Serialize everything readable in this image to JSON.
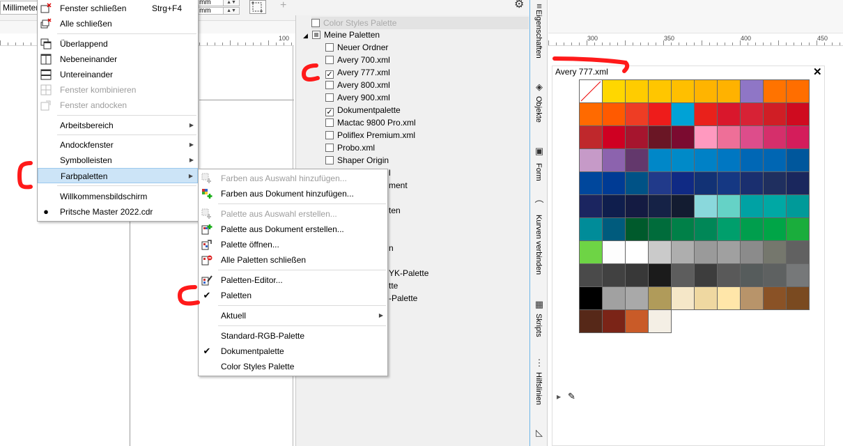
{
  "toolbar": {
    "unit_value": "Millimeter",
    "size_unit_1": "mm",
    "size_unit_2": "mm"
  },
  "ruler_left": {
    "labels": [
      "100"
    ]
  },
  "ruler_right": {
    "labels": [
      "300",
      "350",
      "400",
      "450"
    ]
  },
  "main_menu": {
    "items": [
      {
        "label": "Fenster schließen",
        "shortcut": "Strg+F4",
        "icon": "close-window-icon",
        "enabled": true
      },
      {
        "label": "Alle schließen",
        "icon": "close-all-windows-icon",
        "enabled": true
      },
      {
        "label": "Überlappend",
        "icon": "cascade-icon",
        "enabled": true
      },
      {
        "label": "Nebeneinander",
        "icon": "tile-vertical-icon",
        "enabled": true
      },
      {
        "label": "Untereinander",
        "icon": "tile-horizontal-icon",
        "enabled": true
      },
      {
        "label": "Fenster kombinieren",
        "icon": "combine-windows-icon",
        "enabled": false
      },
      {
        "label": "Fenster andocken",
        "icon": "dock-window-icon",
        "enabled": false
      },
      {
        "label": "Arbeitsbereich",
        "submenu": true,
        "enabled": true
      },
      {
        "label": "Andockfenster",
        "submenu": true,
        "enabled": true
      },
      {
        "label": "Symbolleisten",
        "submenu": true,
        "enabled": true
      },
      {
        "label": "Farbpaletten",
        "submenu": true,
        "enabled": true,
        "highlighted": true
      },
      {
        "label": "Willkommensbildschirm",
        "enabled": true
      },
      {
        "label": "Pritsche Master 2022.cdr",
        "bullet": true,
        "enabled": true
      }
    ]
  },
  "sub_menu": {
    "items": [
      {
        "label": "Farben aus Auswahl hinzufügen...",
        "icon": "add-from-selection-icon",
        "enabled": false
      },
      {
        "label": "Farben aus Dokument hinzufügen...",
        "icon": "add-from-document-icon",
        "enabled": true
      },
      {
        "label": "Palette aus Auswahl erstellen...",
        "icon": "palette-from-selection-icon",
        "enabled": false
      },
      {
        "label": "Palette aus Dokument erstellen...",
        "icon": "palette-from-document-icon",
        "enabled": true
      },
      {
        "label": "Palette öffnen...",
        "icon": "open-palette-icon",
        "enabled": true
      },
      {
        "label": "Alle Paletten schließen",
        "icon": "close-palettes-icon",
        "enabled": true
      },
      {
        "label": "Paletten-Editor...",
        "icon": "palette-editor-icon",
        "enabled": true
      },
      {
        "label": "Paletten",
        "check": true,
        "enabled": true
      },
      {
        "label": "Aktuell",
        "submenu": true,
        "enabled": true
      },
      {
        "label": "Standard-RGB-Palette",
        "enabled": true
      },
      {
        "label": "Dokumentpalette",
        "check": true,
        "enabled": true
      },
      {
        "label": "Color Styles Palette",
        "enabled": true
      }
    ]
  },
  "palette_tree": {
    "color_styles": "Color Styles Palette",
    "root": "Meine Paletten",
    "items": [
      {
        "label": "Neuer Ordner",
        "checked": false
      },
      {
        "label": "Avery 700.xml",
        "checked": false
      },
      {
        "label": "Avery 777.xml",
        "checked": true
      },
      {
        "label": "Avery 800.xml",
        "checked": false
      },
      {
        "label": "Avery 900.xml",
        "checked": false
      },
      {
        "label": "Dokumentpalette",
        "checked": true
      },
      {
        "label": "Mactac 9800 Pro.xml",
        "checked": false
      },
      {
        "label": "Poliflex Premium.xml",
        "checked": false
      },
      {
        "label": "Probo.xml",
        "checked": false
      },
      {
        "label": "Shaper Origin",
        "checked": false
      }
    ],
    "partial_fragments": [
      "l",
      "ment",
      "ten",
      "n",
      "YK-Palette",
      "tte",
      "-Palette"
    ]
  },
  "dock_tabs": [
    {
      "label": "Eigenschaften",
      "icon": "properties-icon"
    },
    {
      "label": "Objekte",
      "icon": "layers-icon"
    },
    {
      "label": "Form",
      "icon": "shape-icon"
    },
    {
      "label": "Kurven verbinden",
      "icon": "join-curves-icon"
    },
    {
      "label": "Skripts",
      "icon": "scripts-icon"
    },
    {
      "label": "Hilfslinien",
      "icon": "guidelines-icon"
    }
  ],
  "palette_window": {
    "title": "Avery 777.xml",
    "swatches": [
      "none",
      "#ffd700",
      "#ffcc00",
      "#ffc600",
      "#ffbf00",
      "#ffb400",
      "#ffb200",
      "#8f76c6",
      "#ff7300",
      "#ff6e00",
      "#ff6a00",
      "#ff5a00",
      "#ee3d24",
      "#ee1c1b",
      "#00a2d6",
      "#e9211b",
      "#d9172c",
      "#d72235",
      "#d01e25",
      "#cf0b1f",
      "#bf282c",
      "#cf0022",
      "#a6152e",
      "#6a1625",
      "#7b0b30",
      "#ff99bf",
      "#ee6f98",
      "#dd4d8b",
      "#d52f6b",
      "#d41d5b",
      "#c69ac8",
      "#8c63ae",
      "#63386c",
      "#0087c8",
      "#008ac8",
      "#0081c6",
      "#0077c2",
      "#0067b5",
      "#0066b3",
      "#00579c",
      "#00479c",
      "#003b94",
      "#005286",
      "#213a8a",
      "#102a84",
      "#123275",
      "#153883",
      "#1a2f6f",
      "#1f2f5f",
      "#1a275d",
      "#1b2560",
      "#0f1e4d",
      "#141b42",
      "#152246",
      "#131c31",
      "#8ad8dc",
      "#65d2c6",
      "#00a2a4",
      "#00a8a4",
      "#009a99",
      "#008c99",
      "#005b7d",
      "#005a2c",
      "#006c3b",
      "#008048",
      "#008757",
      "#009f6c",
      "#009e4d",
      "#00a547",
      "#1aad3c",
      "#6ed445",
      "#fdfdfd",
      "#ffffff",
      "#cacaca",
      "#aeaeae",
      "#9a9a9a",
      "#a0a0a0",
      "#8b8b8b",
      "#75776d",
      "#616161",
      "#4a4a4a",
      "#414141",
      "#383838",
      "#1b1b1b",
      "#5d5d5d",
      "#3d3d3d",
      "#595959",
      "#565c5c",
      "#5e6161",
      "#767879",
      "#000000",
      "#a1a1a1",
      "#a9a9a9",
      "#b09b5a",
      "#f5e7c8",
      "#efd8a1",
      "#ffe6a9",
      "#b8946a",
      "#8a5226",
      "#7a4a20",
      "#562818",
      "#7b2417",
      "#c95b28",
      "#f4efe5"
    ]
  },
  "colors": {
    "accent": "#cce4f7",
    "annotation": "#ff0000"
  }
}
